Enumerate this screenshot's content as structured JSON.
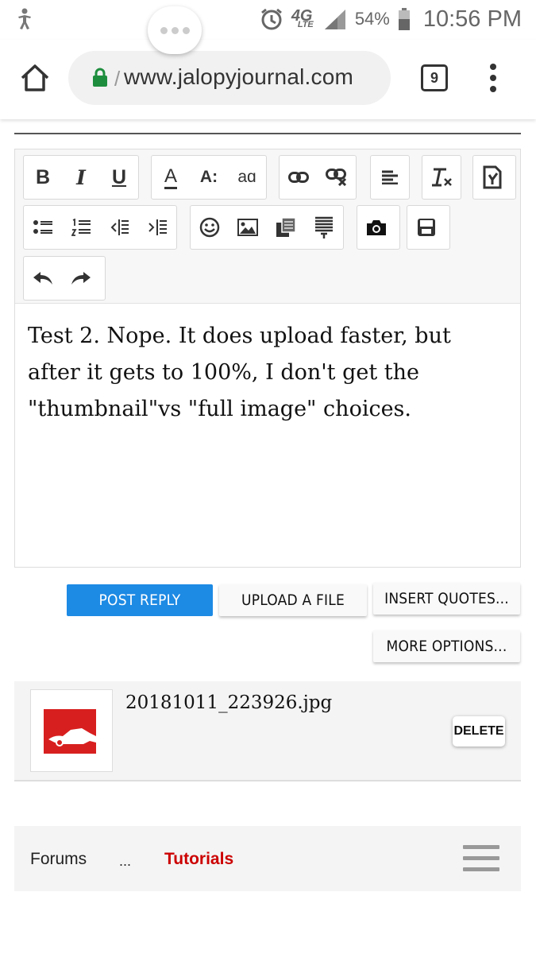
{
  "status_bar": {
    "network": "4G",
    "network_sub": "LTE",
    "battery": "54%",
    "time": "10:56 PM"
  },
  "browser": {
    "url": "www.jalopyjournal.com",
    "tab_count": "9"
  },
  "editor": {
    "toolbar": {
      "groups": [
        [
          "bold-icon",
          "italic-icon",
          "underline-icon"
        ],
        [
          "font-color-icon",
          "font-size-icon",
          "font-family-icon"
        ],
        [
          "link-icon",
          "unlink-icon"
        ],
        [
          "align-icon"
        ],
        [
          "clear-format-icon"
        ],
        [
          "toggle-bbcode-icon"
        ],
        [
          "bullet-list-icon",
          "numbered-list-icon",
          "outdent-icon",
          "indent-icon"
        ],
        [
          "smilie-icon",
          "image-icon",
          "media-icon",
          "insert-quote-icon"
        ],
        [
          "camera-icon"
        ],
        [
          "save-draft-icon"
        ],
        [
          "undo-icon",
          "redo-icon"
        ]
      ],
      "bold_label": "B",
      "italic_label": "I",
      "underline_label": "U",
      "font_color_label": "A",
      "font_size_label": "A:",
      "font_family_label": "aɑ"
    },
    "content_lines": [
      "Test 2. Nope. It does upload faster, but",
      "after it gets to 100%, I don't get the",
      "\"thumbnail\"vs \"full image\" choices."
    ]
  },
  "actions": {
    "post_reply": "POST REPLY",
    "upload_file": "UPLOAD A FILE",
    "insert_quotes": "INSERT QUOTES...",
    "more_options": "MORE OPTIONS..."
  },
  "attachment": {
    "filename": "20181011_223926.jpg",
    "delete_label": "DELETE"
  },
  "footer": {
    "forums": "Forums",
    "ellipsis": "...",
    "tutorials": "Tutorials",
    "tutorials_color": "#cc0000"
  },
  "colors": {
    "primary_button": "#1d8ae4",
    "lock_green": "#1e8e3e"
  }
}
